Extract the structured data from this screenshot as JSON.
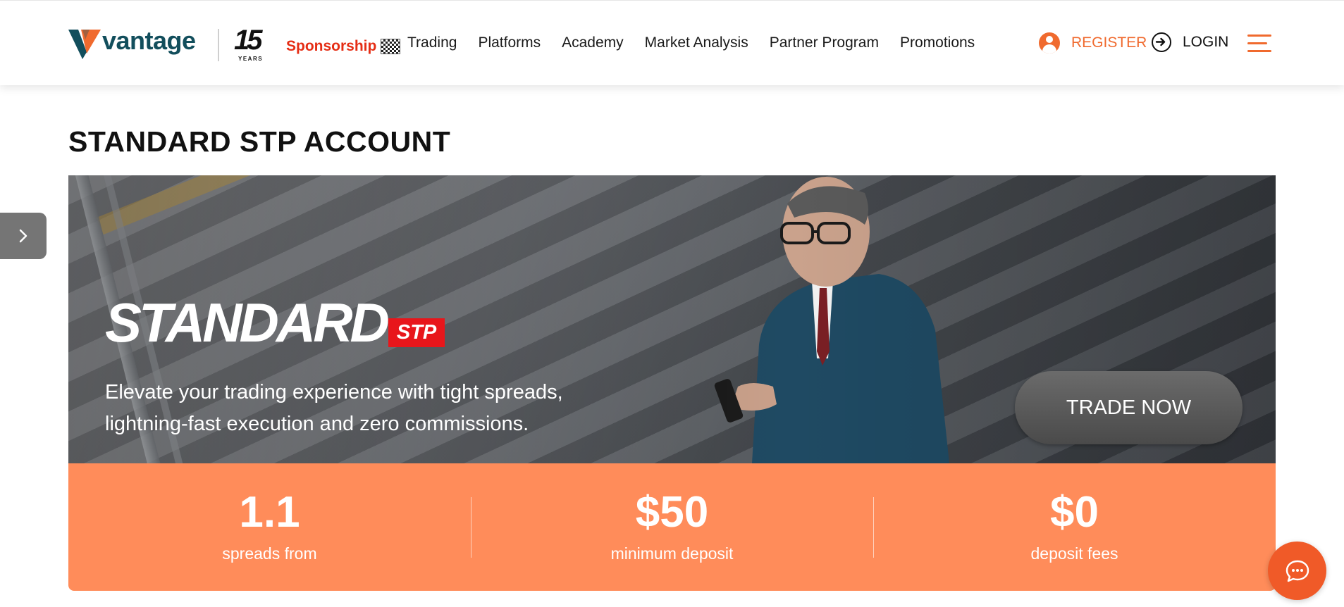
{
  "header": {
    "logo_text": "vantage",
    "years_number": "15",
    "years_label": "YEARS",
    "sponsorship_label": "Sponsorship",
    "nav": [
      {
        "label": "Trading"
      },
      {
        "label": "Platforms"
      },
      {
        "label": "Academy"
      },
      {
        "label": "Market Analysis"
      },
      {
        "label": "Partner Program"
      },
      {
        "label": "Promotions"
      }
    ],
    "register_label": "REGISTER",
    "login_label": "LOGIN",
    "icons": [
      "user-icon",
      "login-arrow-icon",
      "hamburger-menu-icon"
    ]
  },
  "page_title": "STANDARD STP ACCOUNT",
  "hero": {
    "brand_word": "STANDARD",
    "brand_tag": "STP",
    "description": "Elevate your trading experience with tight spreads, lightning-fast execution and zero commissions.",
    "cta_label": "TRADE NOW"
  },
  "stats": [
    {
      "value": "1.1",
      "label": "spreads from"
    },
    {
      "value": "$50",
      "label": "minimum deposit"
    },
    {
      "value": "$0",
      "label": "deposit fees"
    }
  ],
  "colors": {
    "brand_teal": "#124e5c",
    "accent_orange": "#f06a2e",
    "stats_bg": "#ff8c5a",
    "stp_red": "#e8161b",
    "chat_bg": "#f05a28"
  },
  "side_tab_icon": "chevron-right-icon",
  "chat_icon": "chat-bubble-icon"
}
